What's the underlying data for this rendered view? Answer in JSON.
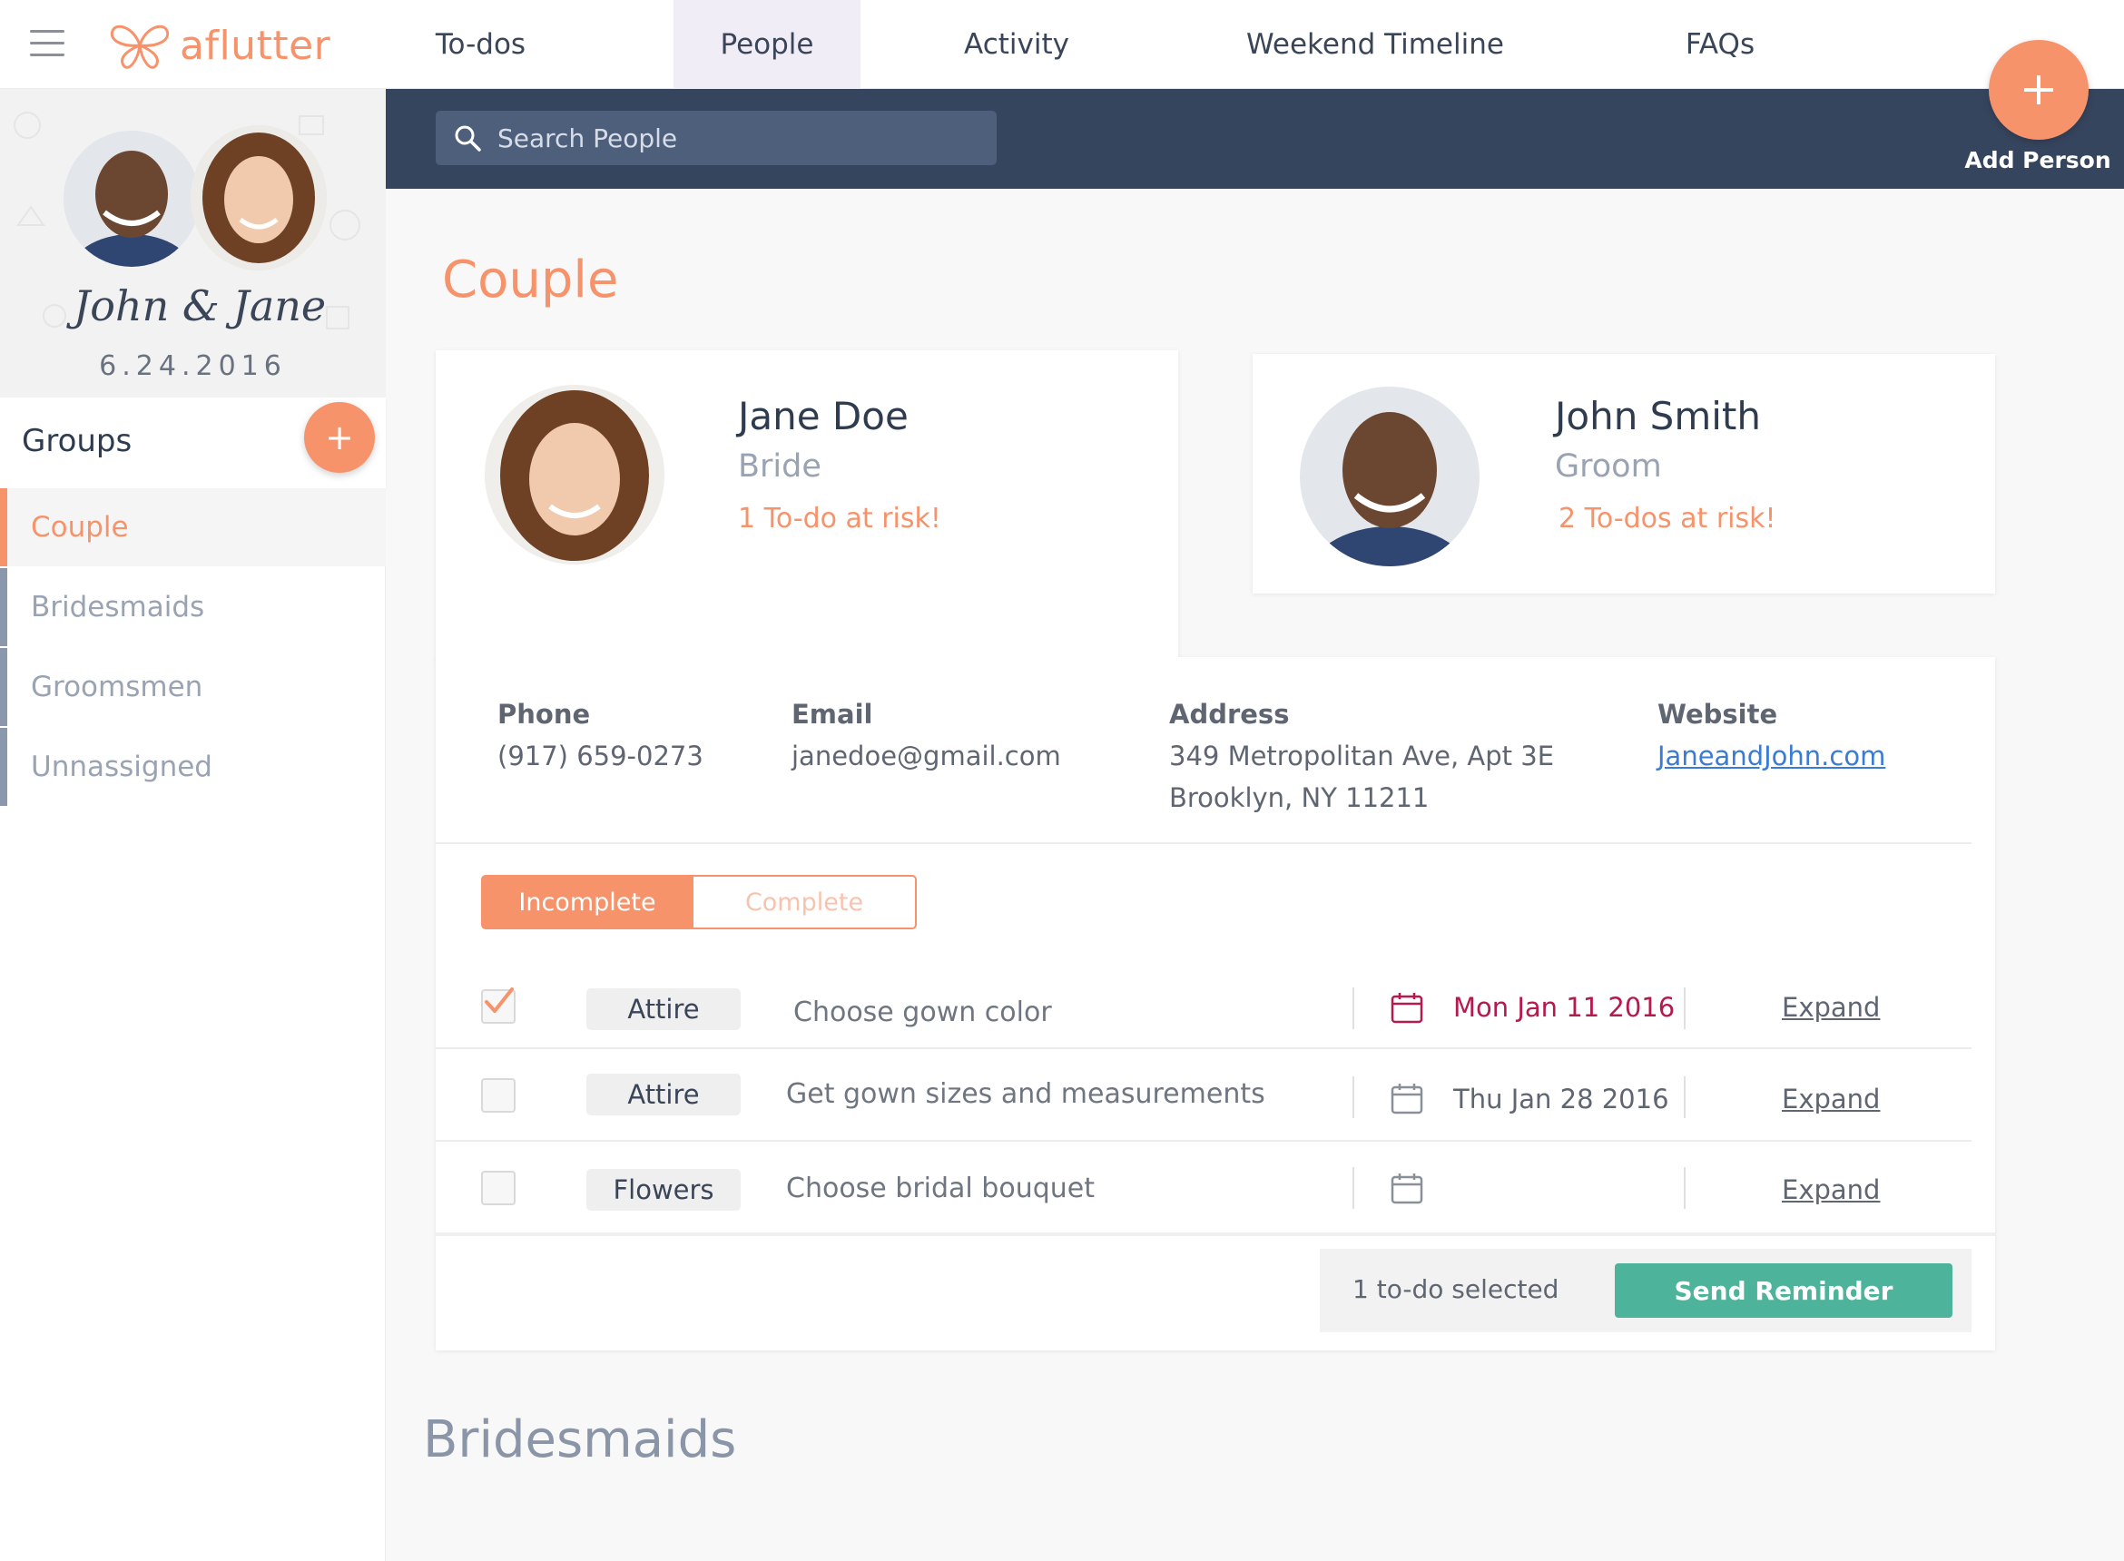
{
  "brand": {
    "name": "aflutter",
    "accent": "#f7936b"
  },
  "nav": {
    "tabs": [
      {
        "label": "To-dos"
      },
      {
        "label": "People"
      },
      {
        "label": "Activity"
      },
      {
        "label": "Weekend Timeline"
      },
      {
        "label": "FAQs"
      }
    ],
    "active_tab": "People"
  },
  "sidebar": {
    "couple_names": "John & Jane",
    "wedding_date": "6.24.2016",
    "groups_title": "Groups",
    "groups": [
      {
        "label": "Couple",
        "active": true
      },
      {
        "label": "Bridesmaids",
        "active": false
      },
      {
        "label": "Groomsmen",
        "active": false
      },
      {
        "label": "Unnassigned",
        "active": false
      }
    ]
  },
  "search": {
    "placeholder": "Search People"
  },
  "add_person": {
    "label": "Add Person",
    "icon": "plus-icon"
  },
  "couple_section": {
    "title": "Couple",
    "people": [
      {
        "name": "Jane Doe",
        "role": "Bride",
        "risk": "1 To-do at risk!"
      },
      {
        "name": "John Smith",
        "role": "Groom",
        "risk": "2 To-dos at risk!"
      }
    ],
    "details": {
      "phone_label": "Phone",
      "phone": "(917) 659-0273",
      "email_label": "Email",
      "email": "janedoe@gmail.com",
      "address_label": "Address",
      "address_line1": "349 Metropolitan Ave, Apt 3E",
      "address_line2": "Brooklyn, NY 11211",
      "website_label": "Website",
      "website": "JaneandJohn.com"
    },
    "filter": {
      "incomplete": "Incomplete",
      "complete": "Complete",
      "selected": "Incomplete"
    },
    "todos": [
      {
        "checked": true,
        "category": "Attire",
        "text": "Choose gown color",
        "date": "Mon Jan 11 2016",
        "overdue": true,
        "action": "Expand"
      },
      {
        "checked": false,
        "category": "Attire",
        "text": "Get gown sizes and measurements",
        "date": "Thu Jan 28 2016",
        "overdue": false,
        "action": "Expand"
      },
      {
        "checked": false,
        "category": "Flowers",
        "text": "Choose bridal bouquet",
        "date": "",
        "overdue": false,
        "action": "Expand"
      }
    ],
    "selected_count": "1 to-do selected",
    "send_reminder": "Send Reminder"
  },
  "next_section": {
    "title": "Bridesmaids"
  },
  "colors": {
    "accent": "#f7936b",
    "navy": "#36455e",
    "success": "#4db39a",
    "overdue": "#b31a4d",
    "link": "#3b7bd6"
  }
}
